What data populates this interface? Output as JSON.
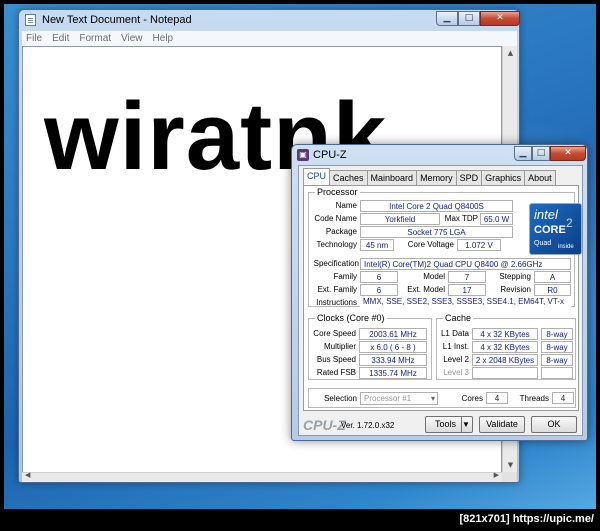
{
  "notepad": {
    "title": "New Text Document - Notepad",
    "menu": [
      "File",
      "Edit",
      "Format",
      "View",
      "Help"
    ],
    "content": "wiratnk"
  },
  "cpuz": {
    "title": "CPU-Z",
    "tabs": [
      "CPU",
      "Caches",
      "Mainboard",
      "Memory",
      "SPD",
      "Graphics",
      "About"
    ],
    "active_tab": "CPU",
    "processor": {
      "legend": "Processor",
      "name_label": "Name",
      "name": "Intel Core 2 Quad Q8400S",
      "codename_label": "Code Name",
      "codename": "Yorkfield",
      "maxtdp_label": "Max TDP",
      "maxtdp": "65.0 W",
      "package_label": "Package",
      "package": "Socket 775 LGA",
      "technology_label": "Technology",
      "technology": "45 nm",
      "corevoltage_label": "Core Voltage",
      "corevoltage": "1.072 V",
      "spec_label": "Specification",
      "spec": "Intel(R) Core(TM)2 Quad CPU    Q8400  @ 2.66GHz",
      "family_label": "Family",
      "family": "6",
      "model_label": "Model",
      "model": "7",
      "stepping_label": "Stepping",
      "stepping": "A",
      "extfamily_label": "Ext. Family",
      "extfamily": "6",
      "extmodel_label": "Ext. Model",
      "extmodel": "17",
      "revision_label": "Revision",
      "revision": "R0",
      "instructions_label": "Instructions",
      "instructions": "MMX, SSE, SSE2, SSE3, SSSE3, SSE4.1, EM64T, VT-x"
    },
    "intel_logo": {
      "brand": "intel",
      "line1": "CORE",
      "line2": "Quad",
      "line3": "inside",
      "sup": "2"
    },
    "clocks": {
      "legend": "Clocks (Core #0)",
      "corespeed_label": "Core Speed",
      "corespeed": "2003.61 MHz",
      "multiplier_label": "Multiplier",
      "multiplier": "x 6.0 ( 6 - 8 )",
      "busspeed_label": "Bus Speed",
      "busspeed": "333.94 MHz",
      "ratedfsb_label": "Rated FSB",
      "ratedfsb": "1335.74 MHz"
    },
    "cache": {
      "legend": "Cache",
      "l1d_label": "L1 Data",
      "l1d": "4 x 32 KBytes",
      "l1d_way": "8-way",
      "l1i_label": "L1 Inst.",
      "l1i": "4 x 32 KBytes",
      "l1i_way": "8-way",
      "l2_label": "Level 2",
      "l2": "2 x 2048 KBytes",
      "l2_way": "8-way",
      "l3_label": "Level 3"
    },
    "selection": {
      "label": "Selection",
      "value": "Processor #1",
      "cores_label": "Cores",
      "cores": "4",
      "threads_label": "Threads",
      "threads": "4"
    },
    "footer": {
      "brand": "CPU-Z",
      "version": "Ver. 1.72.0.x32",
      "tools": "Tools",
      "validate": "Validate",
      "ok": "OK"
    }
  },
  "watermark": "[821x701] https://upic.me/"
}
